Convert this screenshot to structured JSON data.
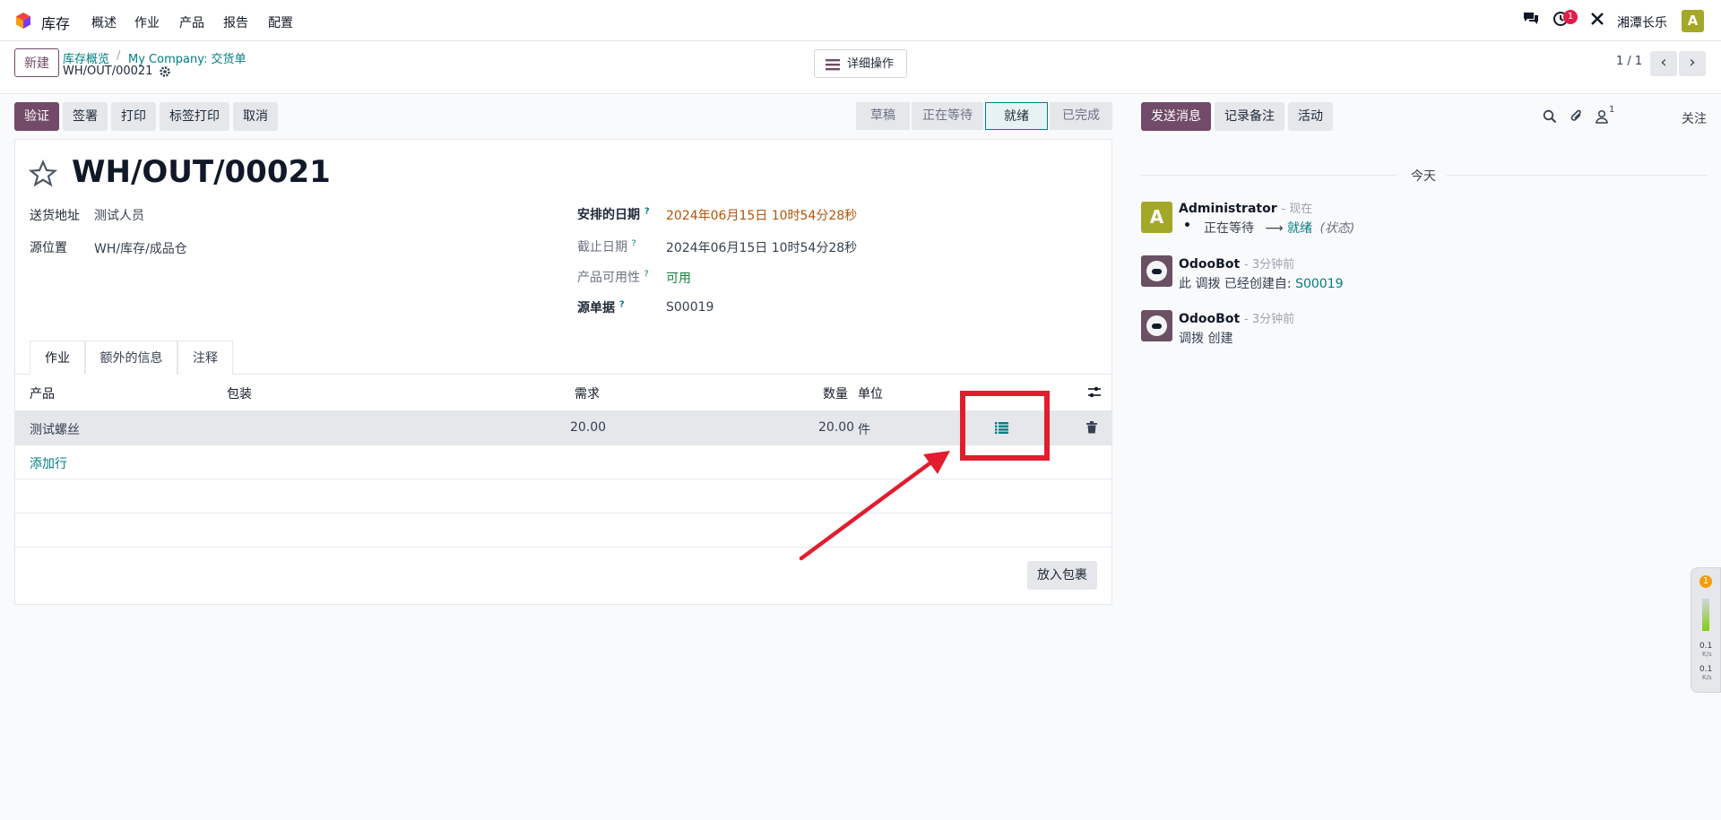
{
  "topbar": {
    "app_name": "库存",
    "menus": [
      "概述",
      "作业",
      "产品",
      "报告",
      "配置"
    ],
    "activity_count": "1",
    "company": "湘潭长乐",
    "avatar_letter": "A"
  },
  "control": {
    "new_label": "新建",
    "breadcrumb_1": "库存概览",
    "breadcrumb_sep": "/",
    "breadcrumb_2": "My Company: 交货单",
    "record_name": "WH/OUT/00021",
    "actions_label": "详细操作",
    "pager": "1 / 1"
  },
  "buttons": {
    "validate": "验证",
    "sign": "签署",
    "print": "打印",
    "print_labels": "标签打印",
    "cancel": "取消"
  },
  "status": [
    "草稿",
    "正在等待",
    "就绪",
    "已完成"
  ],
  "form": {
    "title": "WH/OUT/00021",
    "delivery_address_label": "送货地址",
    "delivery_address": "测试人员",
    "source_location_label": "源位置",
    "source_location": "WH/库存/成品仓",
    "scheduled_date_label": "安排的日期",
    "scheduled_date": "2024年06月15日 10时54分28秒",
    "deadline_label": "截止日期",
    "deadline": "2024年06月15日 10时54分28秒",
    "availability_label": "产品可用性",
    "availability": "可用",
    "source_doc_label": "源单据",
    "source_doc": "S00019",
    "help_mark": "?"
  },
  "tabs": [
    "作业",
    "额外的信息",
    "注释"
  ],
  "table": {
    "headers": {
      "product": "产品",
      "packaging": "包装",
      "demand": "需求",
      "quantity": "数量",
      "uom": "单位"
    },
    "rows": [
      {
        "product": "测试螺丝",
        "demand": "20.00",
        "quantity": "20.00",
        "uom": "件"
      }
    ],
    "add_line": "添加行",
    "put_in_pack": "放入包裹"
  },
  "chatter": {
    "send_message": "发送消息",
    "log_note": "记录备注",
    "activities": "活动",
    "follower_count": "1",
    "follow": "关注",
    "today": "今天",
    "messages": [
      {
        "author": "Administrator",
        "time": "- 现在",
        "from": "正在等待",
        "arrow": "⟶",
        "to": "就绪",
        "field": "(状态)"
      },
      {
        "author": "OdooBot",
        "time": "- 3分钟前",
        "text": "此 调拨 已经创建自:",
        "link": "S00019"
      },
      {
        "author": "OdooBot",
        "time": "- 3分钟前",
        "text": "调拨 创建"
      }
    ]
  },
  "net_widget": {
    "badge": "1",
    "up": "0.1",
    "up_unit": "K/s",
    "down": "0.1",
    "down_unit": "K/s"
  }
}
